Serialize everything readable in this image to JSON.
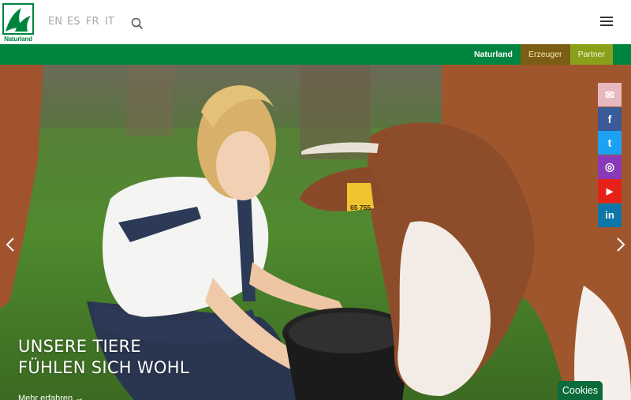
{
  "header": {
    "logo_text": "Naturland",
    "languages": [
      "EN",
      "ES",
      "FR",
      "IT"
    ],
    "search_icon": "search-icon",
    "menu_icon": "hamburger-menu-icon"
  },
  "nav": {
    "tabs": [
      {
        "label": "Naturland",
        "color": "#008540"
      },
      {
        "label": "Erzeuger",
        "color": "#7b5e14"
      },
      {
        "label": "Partner",
        "color": "#8aa019"
      }
    ]
  },
  "hero": {
    "headline_line1": "UNSERE TIERE",
    "headline_line2": "FÜHLEN SICH WOHL",
    "more_link": "Mehr erfahren →",
    "ear_tag": "65 755",
    "prev_icon": "chevron-left-icon",
    "next_icon": "chevron-right-icon"
  },
  "social": {
    "items": [
      {
        "icon": "mail-icon",
        "glyph": "✉",
        "color": "#e7b8bd"
      },
      {
        "icon": "facebook-icon",
        "glyph": "f",
        "color": "#3a5a98"
      },
      {
        "icon": "twitter-icon",
        "glyph": "t",
        "color": "#1da1f2"
      },
      {
        "icon": "instagram-icon",
        "glyph": "◎",
        "color": "#8a3ab9"
      },
      {
        "icon": "youtube-icon",
        "glyph": "▶",
        "color": "#e62117"
      },
      {
        "icon": "linkedin-icon",
        "glyph": "in",
        "color": "#0e76a8"
      }
    ]
  },
  "cookies": {
    "label": "Cookies"
  },
  "colors": {
    "brand_green": "#008540"
  }
}
